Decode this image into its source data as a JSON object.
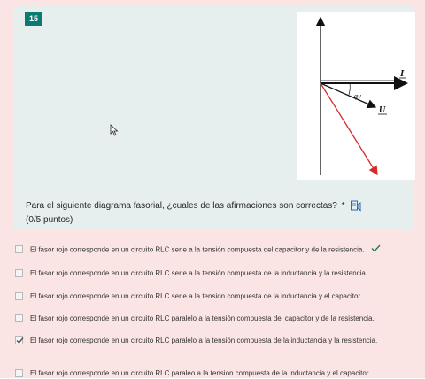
{
  "question": {
    "number": "15",
    "text": "Para el siguiente diagrama fasorial, ¿cuales de las afirmaciones son correctas?",
    "required_mark": "*",
    "points": "(0/5 puntos)"
  },
  "diagram": {
    "labels": {
      "current": "I",
      "voltage": "U",
      "angle": "φv"
    },
    "colors": {
      "black": "#111111",
      "red": "#d42a2a"
    }
  },
  "options": [
    {
      "label": "El fasor rojo corresponde en un circuito RLC serie a la tensión compuesta del capacitor y de la resistencia.",
      "checked": false,
      "correct_mark": true
    },
    {
      "label": "El fasor rojo corresponde en un circuito RLC serie a la tensión compuesta de la inductancia y la resistencia.",
      "checked": false,
      "correct_mark": false
    },
    {
      "label": "El fasor rojo corresponde en un circuito RLC serie a la tension compuesta de la inductancia y el capacitor.",
      "checked": false,
      "correct_mark": false
    },
    {
      "label": "El fasor rojo corresponde en un circuito RLC paralelo a la tensión compuesta del capacitor y de la resistencia.",
      "checked": false,
      "correct_mark": false
    },
    {
      "label": "El fasor rojo corresponde en un circuito RLC paralelo a la tensión compuesta de la inductancia y la resistencia.",
      "checked": true,
      "correct_mark": false
    },
    {
      "label": "El fasor rojo corresponde en un circuito RLC paraleo a la tension compuesta de la inductancia y el capacitor.",
      "checked": false,
      "correct_mark": false
    }
  ],
  "accent_color": "#0b7a73",
  "correct_color": "#1f7a4d"
}
